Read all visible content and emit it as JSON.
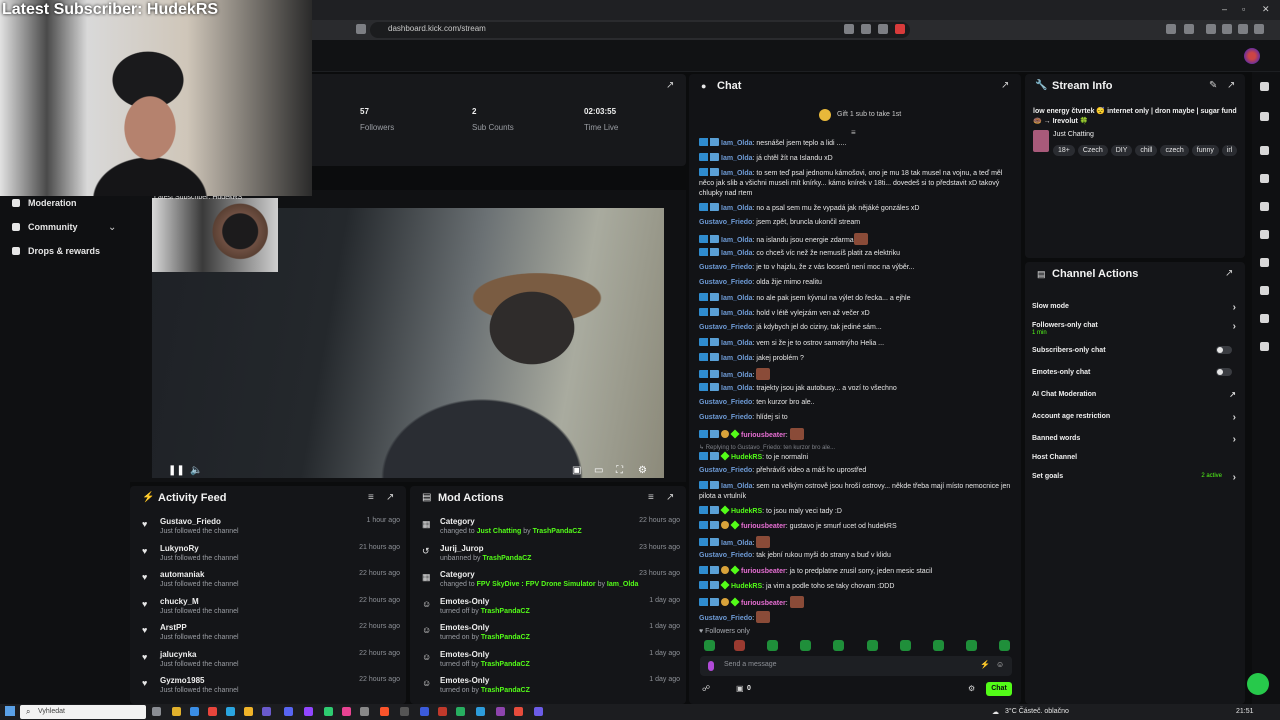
{
  "browser": {
    "url": "dashboard.kick.com/stream"
  },
  "webcam": {
    "caption": "Latest Subscriber: HudekRS"
  },
  "sidebar": {
    "items": [
      {
        "label": "Moderation",
        "icon": "shield-icon"
      },
      {
        "label": "Community",
        "icon": "users-icon"
      },
      {
        "label": "Drops & rewards",
        "icon": "gift-icon"
      }
    ]
  },
  "stats": [
    {
      "value": "57",
      "label": "Followers"
    },
    {
      "value": "2",
      "label": "Sub Counts"
    },
    {
      "value": "02:03:55",
      "label": "Time Live"
    }
  ],
  "video": {
    "inset_caption": "Latest Subscriber: HudekRS"
  },
  "activity_feed": {
    "title": "Activity Feed",
    "items": [
      {
        "name": "Gustavo_Friedo",
        "sub": "Just followed the channel",
        "time": "1 hour ago"
      },
      {
        "name": "LukynoRy",
        "sub": "Just followed the channel",
        "time": "21 hours ago"
      },
      {
        "name": "automaniak",
        "sub": "Just followed the channel",
        "time": "22 hours ago"
      },
      {
        "name": "chucky_M",
        "sub": "Just followed the channel",
        "time": "22 hours ago"
      },
      {
        "name": "ArstPP",
        "sub": "Just followed the channel",
        "time": "22 hours ago"
      },
      {
        "name": "jalucynka",
        "sub": "Just followed the channel",
        "time": "22 hours ago"
      },
      {
        "name": "Gyzmo1985",
        "sub": "Just followed the channel",
        "time": "22 hours ago"
      }
    ]
  },
  "mod_actions": {
    "title": "Mod Actions",
    "items": [
      {
        "name": "Category",
        "pre": "changed to ",
        "hl": "Just Chatting",
        "mid": " by ",
        "by": "TrashPandaCZ",
        "time": "22 hours ago"
      },
      {
        "name": "Jurij_Jurop",
        "pre": "unbanned by ",
        "hl": "",
        "mid": "",
        "by": "TrashPandaCZ",
        "time": "23 hours ago"
      },
      {
        "name": "Category",
        "pre": "changed to ",
        "hl": "FPV SkyDive : FPV Drone Simulator",
        "mid": " by ",
        "by": "Iam_Olda",
        "time": "23 hours ago"
      },
      {
        "name": "Emotes-Only",
        "pre": "turned off by ",
        "hl": "",
        "mid": "",
        "by": "TrashPandaCZ",
        "time": "1 day ago"
      },
      {
        "name": "Emotes-Only",
        "pre": "turned on by ",
        "hl": "",
        "mid": "",
        "by": "TrashPandaCZ",
        "time": "1 day ago"
      },
      {
        "name": "Emotes-Only",
        "pre": "turned off by ",
        "hl": "",
        "mid": "",
        "by": "TrashPandaCZ",
        "time": "1 day ago"
      },
      {
        "name": "Emotes-Only",
        "pre": "turned on by ",
        "hl": "",
        "mid": "",
        "by": "TrashPandaCZ",
        "time": "1 day ago"
      }
    ]
  },
  "chat": {
    "title": "Chat",
    "gift_text": "Gift 1 sub to take 1st",
    "followers_only_label": "Followers only",
    "input_placeholder": "Send a message",
    "send_label": "Chat",
    "points": "0",
    "messages": [
      {
        "user": "Iam_Olda",
        "color": "blue",
        "badges": "blue",
        "text": "nesnášel jsem teplo a lidi ....."
      },
      {
        "user": "Iam_Olda",
        "color": "blue",
        "badges": "blue",
        "text": "já chtěl žít na Islandu xD"
      },
      {
        "user": "Iam_Olda",
        "color": "blue",
        "badges": "blue",
        "text": "to sem teď psal jednomu kámošovi, ono je mu 18 tak musel na vojnu, a teď měl něco jak slib a všichni museli mít knírky... kámo knírek v 18ti... dovedeš si to představit xD takový chlupky nad rtem"
      },
      {
        "user": "Iam_Olda",
        "color": "blue",
        "badges": "blue",
        "text": "no a psal sem mu že vypadá jak nějáké gonzáles xD"
      },
      {
        "user": "Gustavo_Friedo",
        "color": "blue",
        "badges": "",
        "text": "jsem zpět, bruncla ukončil stream"
      },
      {
        "user": "Iam_Olda",
        "color": "blue",
        "badges": "blue",
        "text": "na islandu jsou energie zdarma",
        "emote": true
      },
      {
        "user": "Iam_Olda",
        "color": "blue",
        "badges": "blue",
        "text": "co chceš víc než že nemusíš platit za elektriku"
      },
      {
        "user": "Gustavo_Friedo",
        "color": "blue",
        "badges": "",
        "text": "je to v hajzlu, že z vás looserů není moc na výběr..."
      },
      {
        "user": "Gustavo_Friedo",
        "color": "blue",
        "badges": "",
        "text": "olda žije mimo realitu"
      },
      {
        "user": "Iam_Olda",
        "color": "blue",
        "badges": "blue",
        "text": "no ale pak jsem kývnul na výlet do řecka... a ejhle"
      },
      {
        "user": "Iam_Olda",
        "color": "blue",
        "badges": "blue",
        "text": "hold v létě vylejzám ven až večer xD"
      },
      {
        "user": "Gustavo_Friedo",
        "color": "blue",
        "badges": "",
        "text": "já kdybych jel do ciziny, tak jediné sám..."
      },
      {
        "user": "Iam_Olda",
        "color": "blue",
        "badges": "blue",
        "text": "vem si že je to ostrov samotnýho Helia ..."
      },
      {
        "user": "Iam_Olda",
        "color": "blue",
        "badges": "blue",
        "text": "jakej problém ?"
      },
      {
        "user": "Iam_Olda",
        "color": "blue",
        "badges": "blue",
        "text": "",
        "emote": true
      },
      {
        "user": "Iam_Olda",
        "color": "blue",
        "badges": "blue",
        "text": "trajekty jsou jak autobusy... a vozí to všechno"
      },
      {
        "user": "Gustavo_Friedo",
        "color": "blue",
        "badges": "",
        "text": "ten kurzor bro ale.."
      },
      {
        "user": "Gustavo_Friedo",
        "color": "blue",
        "badges": "",
        "text": "hlídej si to"
      },
      {
        "user": "furiousbeater",
        "color": "pink",
        "badges": "gold",
        "text": "",
        "emote": true
      },
      {
        "user": "",
        "color": "",
        "badges": "",
        "text": "↳ Replying to Gustavo_Friedo: ten kurzor bro ale...",
        "reply": true
      },
      {
        "user": "HudekRS",
        "color": "green",
        "badges": "green",
        "text": "to je normalni"
      },
      {
        "user": "Gustavo_Friedo",
        "color": "blue",
        "badges": "",
        "text": "přehrávíš video a máš ho uprostřed"
      },
      {
        "user": "Iam_Olda",
        "color": "blue",
        "badges": "blue",
        "text": "sem na velkým ostrově jsou hroší ostrovy... někde třeba mají místo nemocnice jen pilota a vrtulník"
      },
      {
        "user": "HudekRS",
        "color": "green",
        "badges": "green",
        "text": "to jsou maly veci tady :D"
      },
      {
        "user": "furiousbeater",
        "color": "pink",
        "badges": "gold",
        "text": "gustavo je smurf ucet od hudekRS"
      },
      {
        "user": "Iam_Olda",
        "color": "blue",
        "badges": "blue",
        "text": "",
        "emote": true
      },
      {
        "user": "Gustavo_Friedo",
        "color": "blue",
        "badges": "",
        "text": "tak jební rukou myši do strany a buď v klidu"
      },
      {
        "user": "furiousbeater",
        "color": "pink",
        "badges": "gold",
        "text": "ja to predplatne zrusil sorry, jeden mesic stacil"
      },
      {
        "user": "HudekRS",
        "color": "green",
        "badges": "green",
        "text": "ja vim a podle toho se taky chovam :DDD"
      },
      {
        "user": "furiousbeater",
        "color": "pink",
        "badges": "gold",
        "text": "",
        "emote": true
      },
      {
        "user": "Gustavo_Friedo",
        "color": "blue",
        "badges": "",
        "text": "",
        "emote": true
      }
    ]
  },
  "stream_info": {
    "title_label": "Stream Info",
    "stream_title": "low energy čtvrtek 😴 internet only | dron maybe | sugar fund 🍩 → Irevolut 🍀",
    "category": "Just Chatting",
    "tags": [
      "18+",
      "Czech",
      "DIY",
      "chill",
      "czech",
      "funny",
      "irl"
    ]
  },
  "channel_actions": {
    "title": "Channel Actions",
    "items": [
      {
        "label": "Slow mode",
        "control": "arrow"
      },
      {
        "label": "Followers-only chat",
        "sub": "1 min",
        "control": "arrow"
      },
      {
        "label": "Subscribers-only chat",
        "control": "toggle"
      },
      {
        "label": "Emotes-only chat",
        "control": "toggle"
      },
      {
        "label": "AI Chat Moderation",
        "control": "external"
      },
      {
        "label": "Account age restriction",
        "control": "arrow"
      },
      {
        "label": "Banned words",
        "control": "arrow"
      },
      {
        "label": "Host Channel",
        "control": "none"
      },
      {
        "label": "Set goals",
        "extra": "2 active",
        "control": "arrow"
      }
    ]
  },
  "taskbar": {
    "search_placeholder": "Vyhledat",
    "weather": "3°C  Částeč. oblačno",
    "time": "21:51"
  },
  "colors": {
    "accent": "#53fc18",
    "panel": "#141518",
    "background": "#0b0c0d"
  }
}
